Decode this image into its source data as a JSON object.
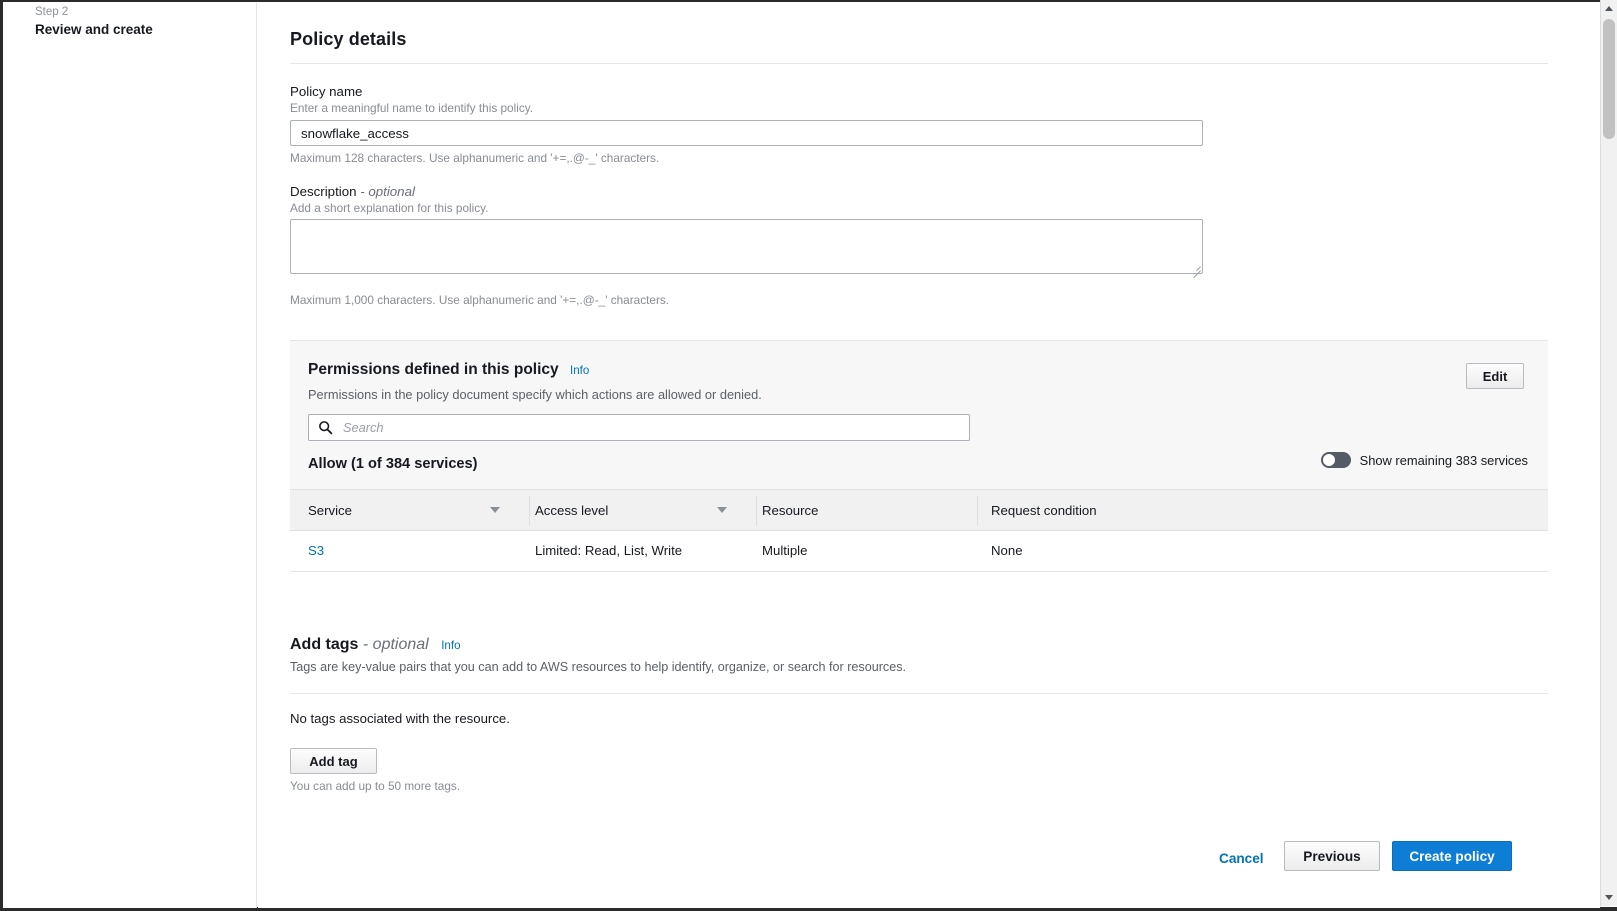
{
  "wizard": {
    "step_number": "Step 2",
    "step_title": "Review and create"
  },
  "policy_details": {
    "heading": "Policy details",
    "name_label": "Policy name",
    "name_hint": "Enter a meaningful name to identify this policy.",
    "name_value": "snowflake_access",
    "name_placeholder": "",
    "name_constraint": "Maximum 128 characters. Use alphanumeric and '+=,.@-_' characters.",
    "description_label": "Description",
    "description_optional": "- optional",
    "description_hint": "Add a short explanation for this policy.",
    "description_value": "",
    "description_placeholder": "",
    "description_constraint": "Maximum 1,000 characters. Use alphanumeric and '+=,.@-_' characters."
  },
  "permissions": {
    "title": "Permissions defined in this policy",
    "info_label": "Info",
    "subtitle": "Permissions in the policy document specify which actions are allowed or denied.",
    "edit_label": "Edit",
    "search_placeholder": "Search",
    "search_value": "",
    "allow_summary": "Allow (1 of 384 services)",
    "toggle_label": "Show remaining 383 services",
    "toggle_state": "off",
    "columns": [
      "Service",
      "Access level",
      "Resource",
      "Request condition"
    ],
    "rows": [
      {
        "service": "S3",
        "access_level": "Limited: Read, List, Write",
        "resource": "Multiple",
        "request_condition": "None"
      }
    ]
  },
  "tags": {
    "title": "Add tags",
    "optional": "- optional",
    "info_label": "Info",
    "description": "Tags are key-value pairs that you can add to AWS resources to help identify, organize, or search for resources.",
    "empty_message": "No tags associated with the resource.",
    "add_button": "Add tag",
    "limit_note": "You can add up to 50 more tags."
  },
  "footer": {
    "cancel": "Cancel",
    "previous": "Previous",
    "create": "Create policy"
  },
  "colors": {
    "link_blue": "#0073bb",
    "primary_button": "#0d7dd6",
    "panel_bg": "#f7f7f7",
    "text": "#16191f"
  }
}
